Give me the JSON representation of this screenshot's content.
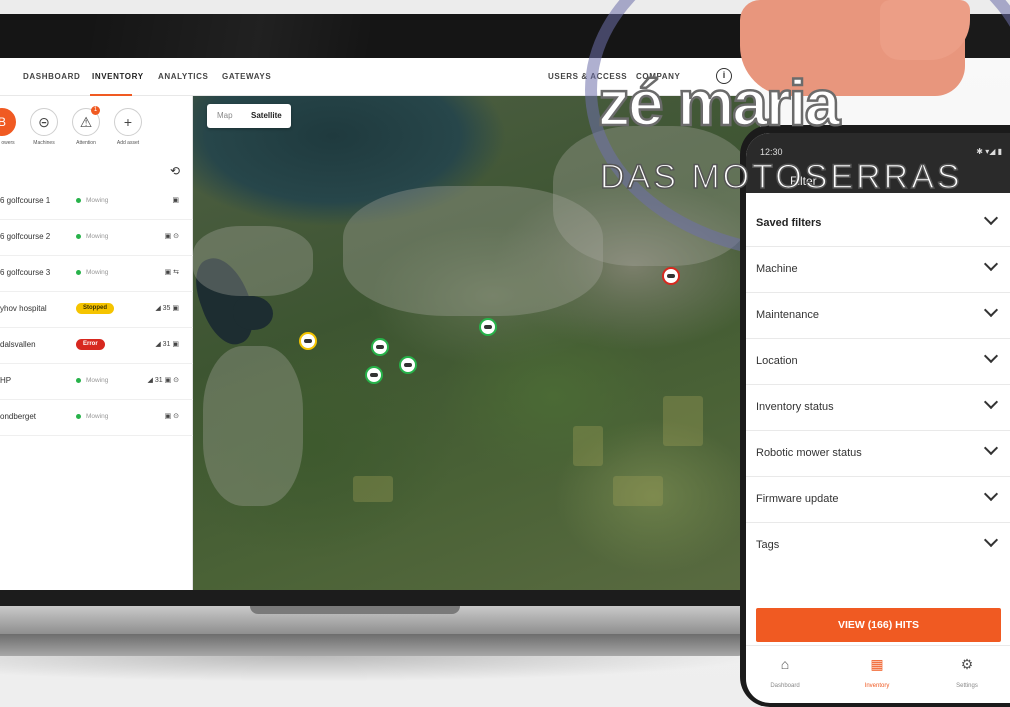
{
  "nav": {
    "items": [
      "DASHBOARD",
      "INVENTORY",
      "ANALYTICS",
      "GATEWAYS"
    ],
    "right_items": [
      "USERS & ACCESS",
      "COMPANY"
    ],
    "active": "INVENTORY"
  },
  "assets": {
    "buttons": [
      {
        "label": "owers",
        "icon": "mower-icon"
      },
      {
        "label": "Machines",
        "icon": "machine-icon"
      },
      {
        "label": "Attention",
        "icon": "warning-icon",
        "badge": "1"
      },
      {
        "label": "Add asset",
        "icon": "plus-icon"
      }
    ]
  },
  "inventory_rows": [
    {
      "name": "6 golfcourse 1",
      "status": "Mowing",
      "icons": "▣"
    },
    {
      "name": "6 golfcourse 2",
      "status": "Mowing",
      "icons": "▣ ⊙"
    },
    {
      "name": "6 golfcourse 3",
      "status": "Mowing",
      "icons": "▣ ⇆"
    },
    {
      "name": "yhov hospital",
      "pill": "Stopped",
      "icons": "◢ 35 ▣"
    },
    {
      "name": "dalsvallen",
      "pill": "Error",
      "icons": "◢ 31 ▣"
    },
    {
      "name": "HP",
      "status": "Mowing",
      "icons": "◢ 31 ▣ ⊙"
    },
    {
      "name": "ondberget",
      "status": "Mowing",
      "icons": "▣ ⊙"
    }
  ],
  "map": {
    "toggle_map": "Map",
    "toggle_satellite": "Satellite"
  },
  "phone": {
    "time": "12:30",
    "title": "Filter",
    "filters": [
      "Saved filters",
      "Machine",
      "Maintenance",
      "Location",
      "Inventory status",
      "Robotic mower status",
      "Firmware update",
      "Tags"
    ],
    "hits_button": "VIEW (166) HITS",
    "bottom_nav": [
      "Dashboard",
      "Inventory",
      "Settings"
    ]
  },
  "watermark": {
    "line1": "zé maria",
    "line2": "DAS MOTOSERRAS"
  },
  "colors": {
    "accent": "#f05a22",
    "mowing": "#27b24a",
    "stopped": "#f5c400",
    "error": "#d7281f"
  }
}
